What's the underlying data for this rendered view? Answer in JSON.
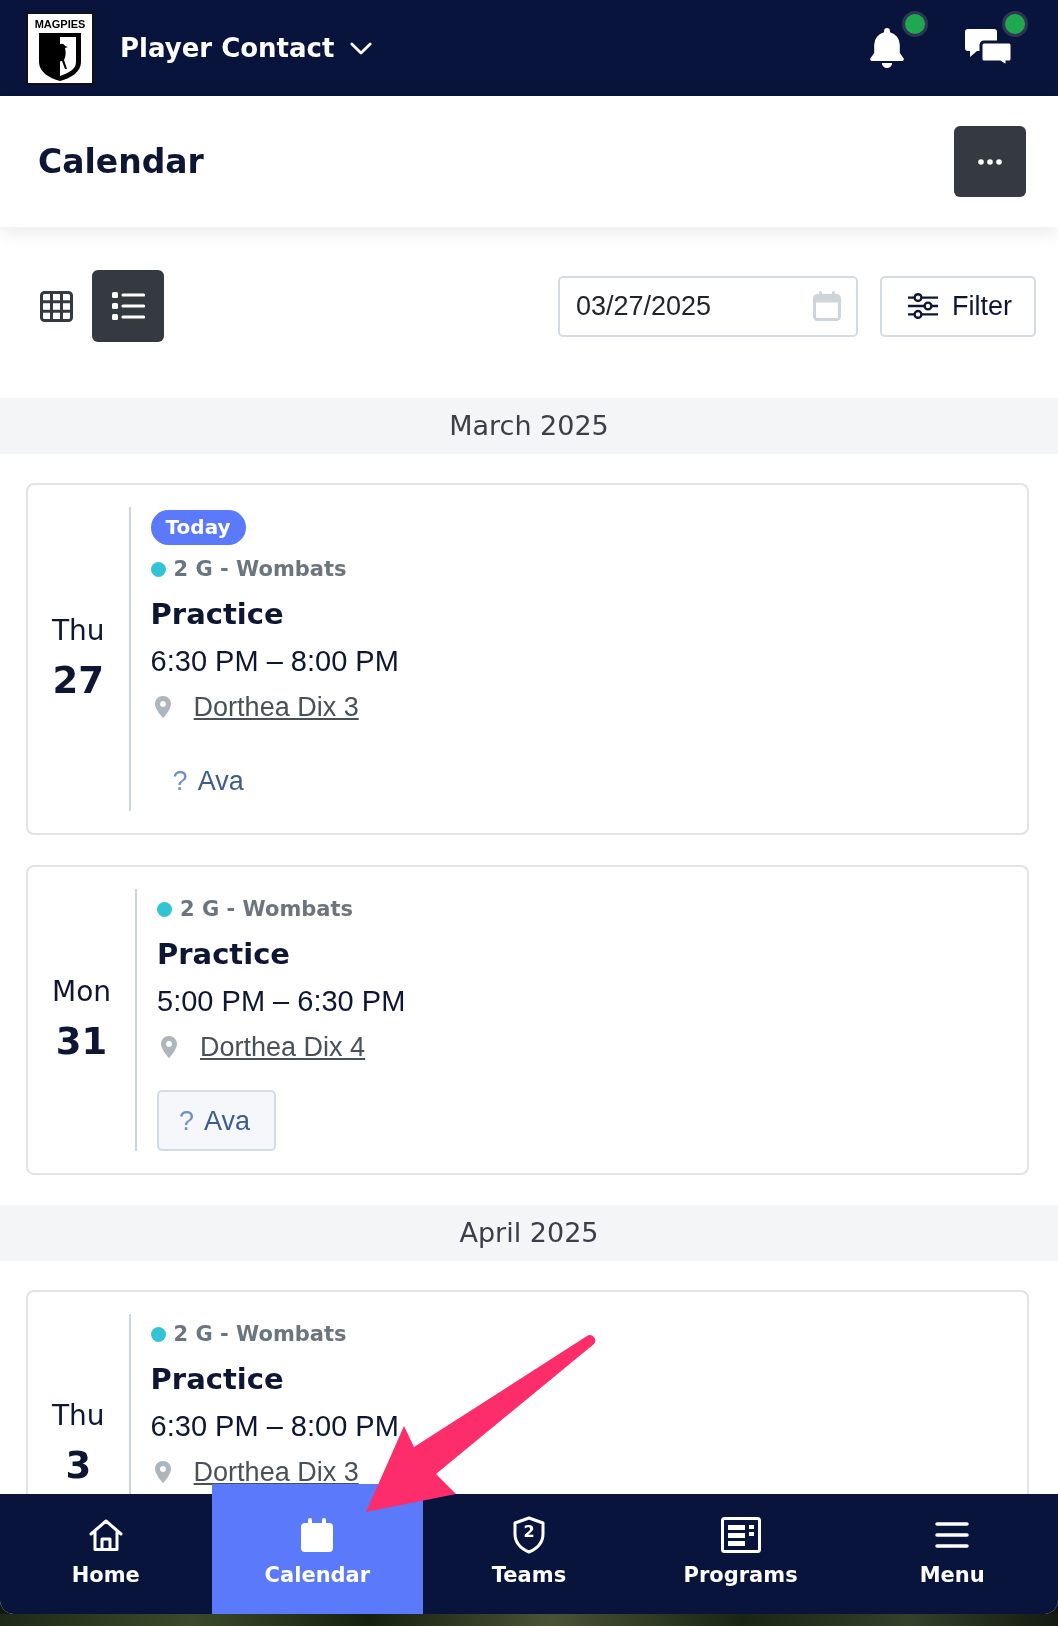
{
  "top_bar": {
    "logo_text": "MAGPIES",
    "title": "Player Contact",
    "actions": [
      {
        "kind": "bell",
        "unread": true
      },
      {
        "kind": "chat",
        "unread": true
      }
    ]
  },
  "page_header": {
    "title": "Calendar"
  },
  "toolbar": {
    "views": [
      {
        "kind": "grid",
        "selected": false
      },
      {
        "kind": "list",
        "selected": true
      }
    ],
    "date_field": {
      "value": "03/27/2025"
    },
    "filter_button": {
      "label": "Filter"
    }
  },
  "months": [
    {
      "label": "March 2025",
      "events": [
        {
          "weekday": "Thu",
          "day": "27",
          "badge": "Today",
          "team": {
            "name": "2 G - Wombats",
            "color": "#33c3d6"
          },
          "title": "Practice",
          "time": "6:30 PM – 8:00 PM",
          "location": "Dorthea Dix 3",
          "attendees": [
            {
              "status": "?",
              "name": "Ava",
              "focused": false
            }
          ]
        },
        {
          "weekday": "Mon",
          "day": "31",
          "team": {
            "name": "2 G - Wombats",
            "color": "#33c3d6"
          },
          "title": "Practice",
          "time": "5:00 PM – 6:30 PM",
          "location": "Dorthea Dix 4",
          "attendees": [
            {
              "status": "?",
              "name": "Ava",
              "focused": true
            }
          ]
        }
      ]
    },
    {
      "label": "April 2025",
      "events": [
        {
          "weekday": "Thu",
          "day": "3",
          "team": {
            "name": "2 G - Wombats",
            "color": "#33c3d6"
          },
          "title": "Practice",
          "time": "6:30 PM – 8:00 PM",
          "location": "Dorthea Dix 3"
        }
      ]
    }
  ],
  "bottom_nav": [
    {
      "kind": "home",
      "label": "Home",
      "selected": false
    },
    {
      "kind": "calendar",
      "label": "Calendar",
      "selected": true
    },
    {
      "kind": "teams",
      "label": "Teams",
      "icon_text": "2",
      "selected": false
    },
    {
      "kind": "programs",
      "label": "Programs",
      "selected": false
    },
    {
      "kind": "menu",
      "label": "Menu",
      "selected": false
    }
  ],
  "annotations": [
    {
      "kind": "arrow"
    }
  ]
}
